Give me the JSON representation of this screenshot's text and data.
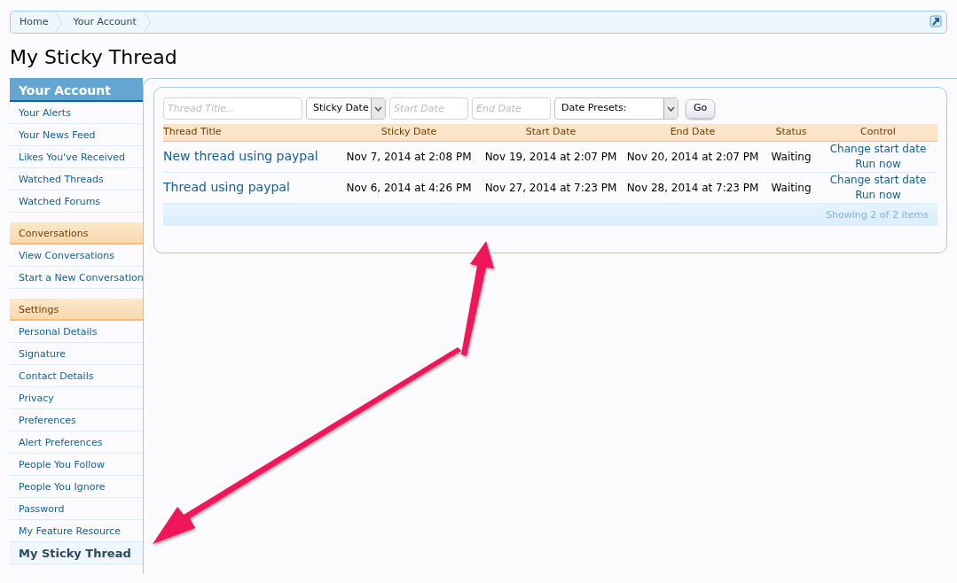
{
  "breadcrumb": [
    {
      "label": "Home"
    },
    {
      "label": "Your Account"
    }
  ],
  "page_title": "My Sticky Thread",
  "sidebar": {
    "sections": [
      {
        "kind": "primary",
        "heading": "Your Account",
        "items": [
          {
            "label": "Your Alerts",
            "selected": false
          },
          {
            "label": "Your News Feed",
            "selected": false
          },
          {
            "label": "Likes You've Received",
            "selected": false
          },
          {
            "label": "Watched Threads",
            "selected": false
          },
          {
            "label": "Watched Forums",
            "selected": false
          }
        ]
      },
      {
        "kind": "secondary",
        "heading": "Conversations",
        "items": [
          {
            "label": "View Conversations",
            "selected": false
          },
          {
            "label": "Start a New Conversation",
            "selected": false
          }
        ]
      },
      {
        "kind": "secondary",
        "heading": "Settings",
        "items": [
          {
            "label": "Personal Details",
            "selected": false
          },
          {
            "label": "Signature",
            "selected": false
          },
          {
            "label": "Contact Details",
            "selected": false
          },
          {
            "label": "Privacy",
            "selected": false
          },
          {
            "label": "Preferences",
            "selected": false
          },
          {
            "label": "Alert Preferences",
            "selected": false
          },
          {
            "label": "People You Follow",
            "selected": false
          },
          {
            "label": "People You Ignore",
            "selected": false
          },
          {
            "label": "Password",
            "selected": false
          },
          {
            "label": "My Feature Resource",
            "selected": false
          },
          {
            "label": "My Sticky Thread",
            "selected": true
          }
        ]
      }
    ]
  },
  "filter": {
    "title_placeholder": "Thread Title...",
    "sort_value": "Sticky Date",
    "start_placeholder": "Start Date",
    "end_placeholder": "End Date",
    "presets_value": "Date Presets:",
    "go_button": "Go"
  },
  "table": {
    "columns": [
      "Thread Title",
      "Sticky Date",
      "Start Date",
      "End Date",
      "Status",
      "Control"
    ],
    "rows": [
      {
        "title": "New thread using paypal",
        "sticky_date": "Nov 7, 2014 at 2:08 PM",
        "start_date": "Nov 19, 2014 at 2:07 PM",
        "end_date": "Nov 20, 2014 at 2:07 PM",
        "status": "Waiting",
        "controls": [
          "Change start date",
          "Run now"
        ]
      },
      {
        "title": "Thread using paypal",
        "sticky_date": "Nov 6, 2014 at 4:26 PM",
        "start_date": "Nov 27, 2014 at 7:23 PM",
        "end_date": "Nov 28, 2014 at 7:23 PM",
        "status": "Waiting",
        "controls": [
          "Change start date",
          "Run now"
        ]
      }
    ],
    "footer": "Showing 2 of 2 items"
  }
}
